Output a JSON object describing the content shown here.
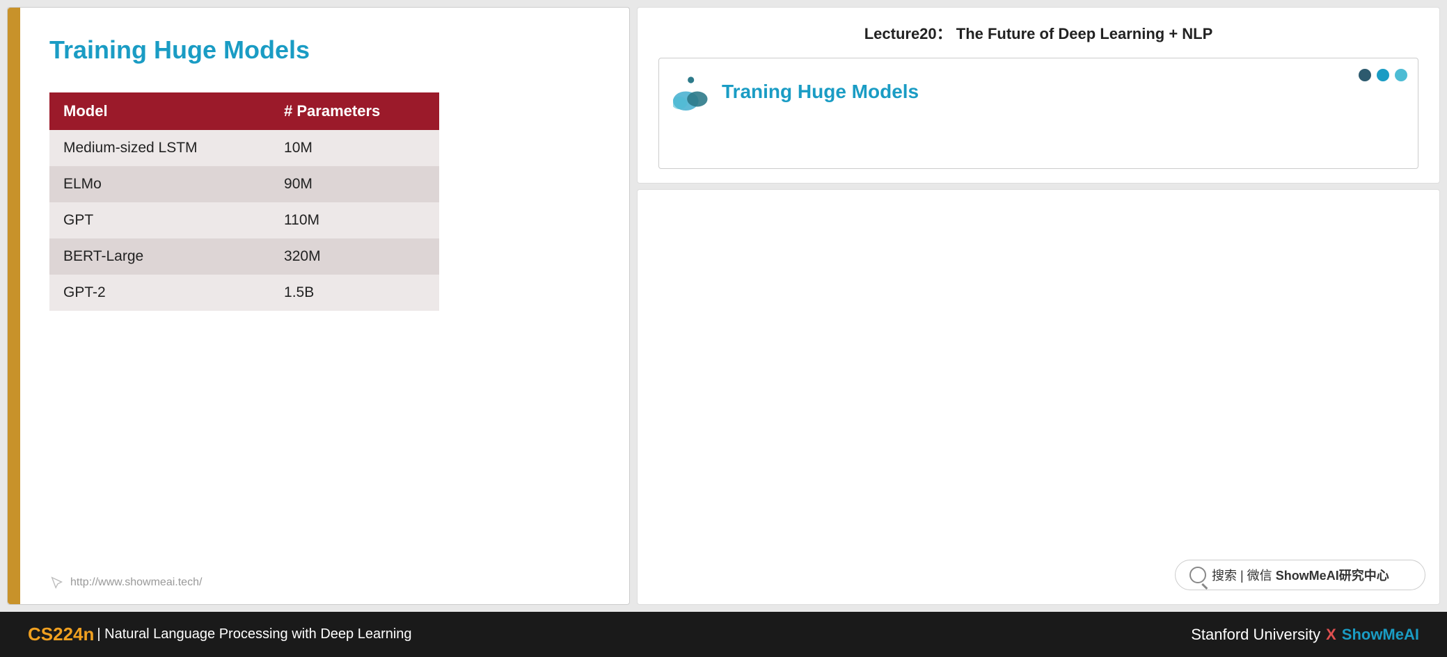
{
  "header": {
    "lecture_title": "Lecture20： The Future of Deep Learning + NLP"
  },
  "slide": {
    "title": "Training Huge Models",
    "table": {
      "col1_header": "Model",
      "col2_header": "# Parameters",
      "rows": [
        {
          "model": "Medium-sized LSTM",
          "params": "10M"
        },
        {
          "model": "ELMo",
          "params": "90M"
        },
        {
          "model": "GPT",
          "params": "110M"
        },
        {
          "model": "BERT-Large",
          "params": "320M"
        },
        {
          "model": "GPT-2",
          "params": "1.5B"
        }
      ]
    },
    "footer_url": "http://www.showmeai.tech/"
  },
  "mini_slide": {
    "title": "Traning Huge Models"
  },
  "search": {
    "text": "搜索 | 微信 ",
    "brand": "ShowMeAI研究中心"
  },
  "footer": {
    "course_code": "CS224n",
    "course_desc": " | Natural Language Processing with Deep Learning",
    "right_text": "Stanford University",
    "x_separator": "X",
    "showmeai": "ShowMeAI"
  }
}
